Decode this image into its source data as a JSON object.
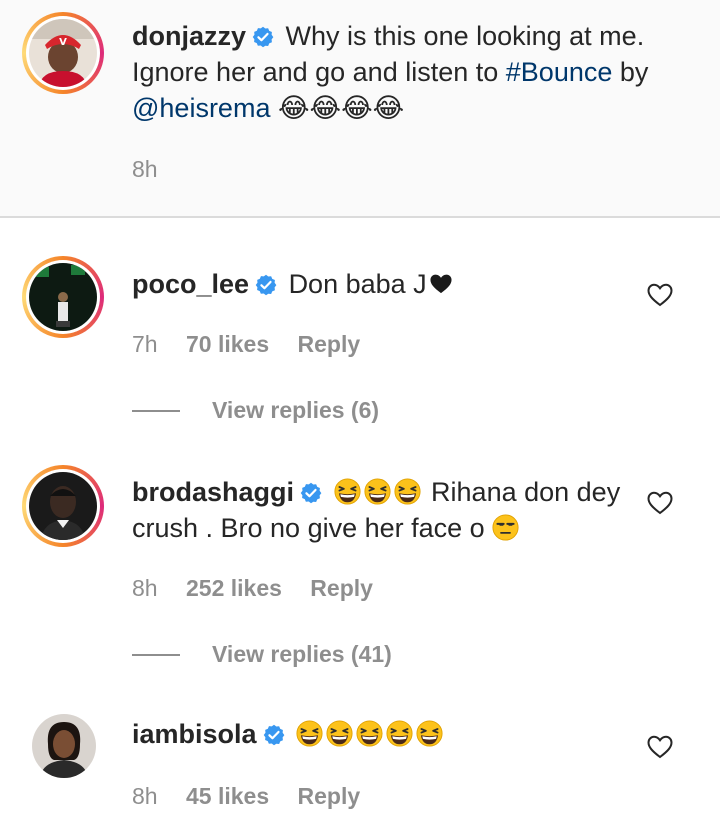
{
  "comments": [
    {
      "username": "donjazzy",
      "text_before": "Why is this one looking at me. Ignore her and go and listen to ",
      "hashtag": "#Bounce",
      "text_mid": " by",
      "mention": "@heisrema",
      "trailing_glyphs": "😂😂😂😂",
      "time": "8h"
    },
    {
      "username": "poco_lee",
      "text": "Don baba J",
      "time": "7h",
      "likes": "70 likes",
      "reply": "Reply",
      "view_replies": "View replies (6)"
    },
    {
      "username": "brodashaggi",
      "emoji_prefix": "grinning-squinting-face x3",
      "text": "Rihana don dey crush . Bro no give her face o",
      "emoji_suffix": "unamused-face",
      "time": "8h",
      "likes": "252 likes",
      "reply": "Reply",
      "view_replies": "View replies (41)"
    },
    {
      "username": "iambisola",
      "emoji": "grinning-squinting-face x5",
      "time": "8h",
      "likes": "45 likes",
      "reply": "Reply"
    }
  ],
  "colors": {
    "text": "#262626",
    "muted": "#8e8e8e",
    "link": "#00376b",
    "verified": "#3897f0",
    "caption_bg": "#fafafa",
    "story_ring": "#dd2a7b"
  },
  "icons": [
    "verified-badge-icon",
    "heart-icon",
    "red-heart-icon",
    "grinning-squinting-face-emoji",
    "unamused-face-emoji"
  ]
}
